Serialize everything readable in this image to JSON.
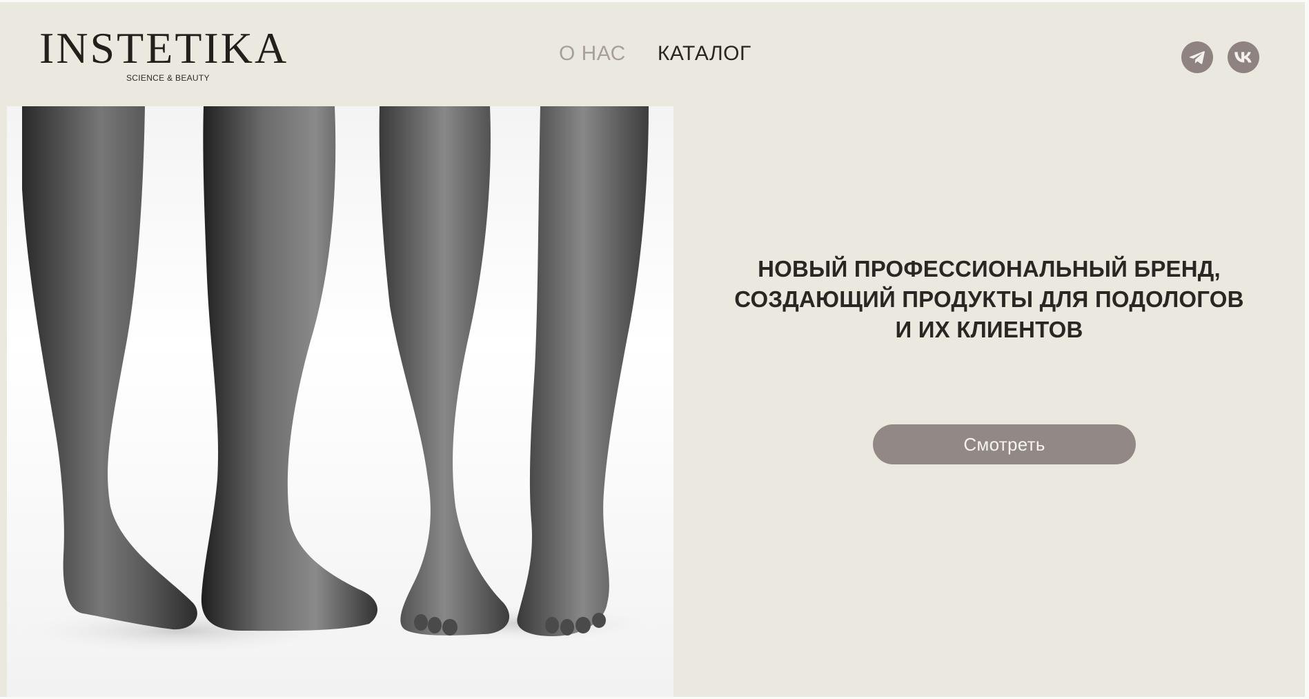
{
  "header": {
    "logo_text": "INSTETIKA",
    "logo_tagline": "SCIENCE & BEAUTY",
    "nav": [
      {
        "label": "О НАС",
        "active": true
      },
      {
        "label": "КАТАЛОГ",
        "active": false
      }
    ],
    "socials": [
      {
        "name": "telegram-icon"
      },
      {
        "name": "vk-icon"
      }
    ]
  },
  "hero": {
    "image_description": "black-and-white-photo-of-two-pairs-of-bare-legs-and-feet",
    "headline_lines": [
      "НОВЫЙ ПРОФЕССИОНАЛЬНЫЙ БРЕНД,",
      "СОЗДАЮЩИЙ ПРОДУКТЫ ДЛЯ ПОДОЛОГОВ",
      "И ИХ КЛИЕНТОВ"
    ],
    "cta_label": "Смотреть"
  },
  "colors": {
    "background": "#ebe8df",
    "accent": "#928885",
    "nav_active": "#a99f9a",
    "text": "#2b2623"
  }
}
